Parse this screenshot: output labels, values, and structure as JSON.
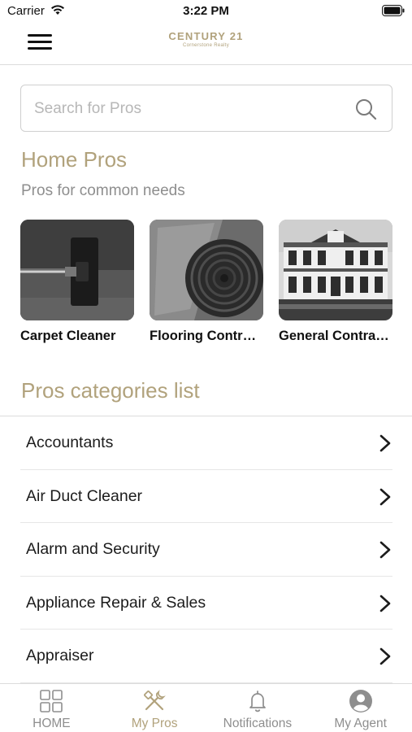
{
  "status_bar": {
    "carrier": "Carrier",
    "time": "3:22 PM"
  },
  "header": {
    "logo_main": "CENTURY 21",
    "logo_sub": "Cornerstone Realty"
  },
  "search": {
    "placeholder": "Search for Pros",
    "value": ""
  },
  "home_pros": {
    "title": "Home Pros",
    "subtitle": "Pros for common needs",
    "cards": [
      {
        "label": "Carpet Cleaner",
        "image": "carpet-cleaner-photo"
      },
      {
        "label": "Flooring Contractors",
        "image": "carpet-roll-photo"
      },
      {
        "label": "General Contractors",
        "image": "house-photo"
      }
    ]
  },
  "categories": {
    "title": "Pros categories list",
    "items": [
      {
        "label": "Accountants"
      },
      {
        "label": "Air Duct Cleaner"
      },
      {
        "label": "Alarm and Security"
      },
      {
        "label": "Appliance Repair & Sales"
      },
      {
        "label": "Appraiser"
      }
    ]
  },
  "tab_bar": {
    "tabs": [
      {
        "label": "HOME",
        "icon": "grid-icon",
        "active": false
      },
      {
        "label": "My Pros",
        "icon": "tools-icon",
        "active": true
      },
      {
        "label": "Notifications",
        "icon": "bell-icon",
        "active": false
      },
      {
        "label": "My Agent",
        "icon": "person-icon",
        "active": false
      }
    ]
  },
  "colors": {
    "accent": "#b1a27c",
    "inactive": "#8e8e8e",
    "text": "#1c1c1c",
    "divider": "#dcdcdc"
  }
}
